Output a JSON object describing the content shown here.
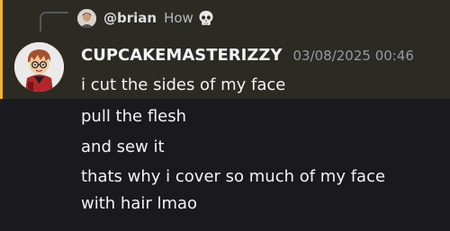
{
  "reply": {
    "username": "@brian",
    "text": "How",
    "emoji_icon": "skull-icon"
  },
  "message": {
    "author": "CUPCAKEMASTERIZZY",
    "timestamp": "03/08/2025 00:46",
    "lines": [
      "i cut the sides of my face",
      "pull the flesh",
      "and sew it",
      "thats why i cover so much of my face",
      "with hair lmao"
    ]
  },
  "colors": {
    "background": "#1a1a1e",
    "highlight": "#2b2b24",
    "mention_bar": "#f0b232"
  }
}
